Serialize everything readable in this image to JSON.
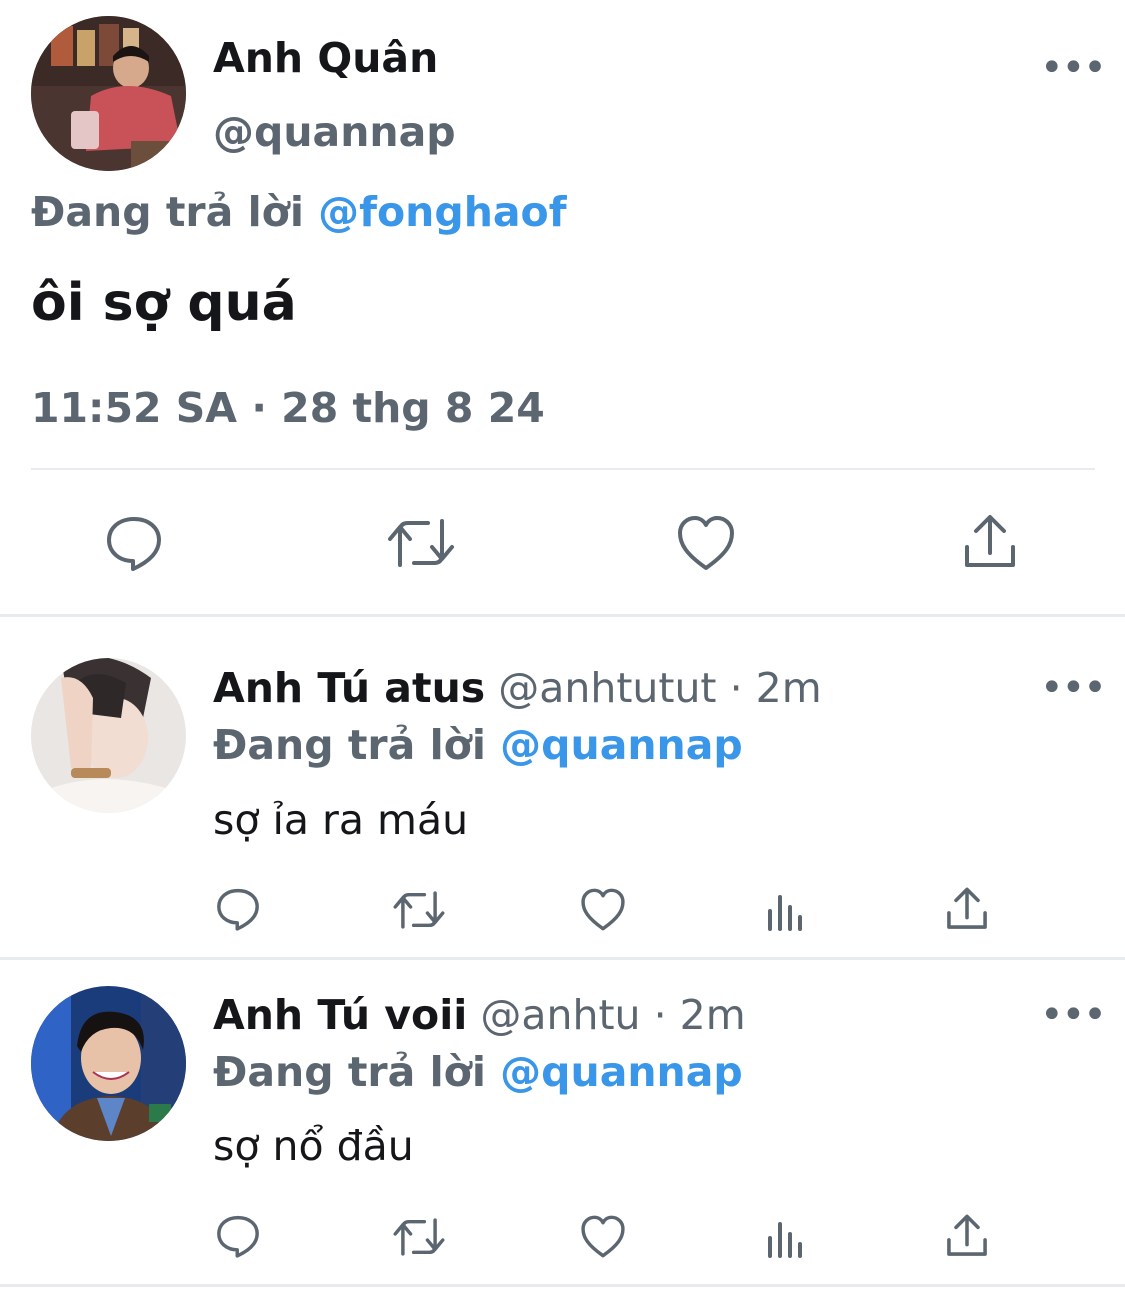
{
  "main_tweet": {
    "author_name": "Anh Quân",
    "handle": "@quannap",
    "replying_prefix": "Đang trả lời",
    "replying_to": "@fonghaof",
    "text": "ôi sợ quá",
    "timestamp": "11:52 SA · 28 thg 8 24",
    "more_label": "•••"
  },
  "replies": [
    {
      "author_name": "Anh Tú atus",
      "handle": "@anhtutut",
      "time": "· 2m",
      "replying_prefix": "Đang trả lời",
      "replying_to": "@quannap",
      "text": "sợ ỉa ra máu",
      "more_label": "•••"
    },
    {
      "author_name": "Anh Tú voii",
      "handle": "@anhtu",
      "time": "· 2m",
      "replying_prefix": "Đang trả lời",
      "replying_to": "@quannap",
      "text": "sợ nổ đầu",
      "more_label": "•••"
    }
  ],
  "icons": {
    "reply": "reply-icon",
    "retweet": "retweet-icon",
    "like": "heart-icon",
    "views": "analytics-icon",
    "share": "share-icon"
  },
  "colors": {
    "text": "#141619",
    "secondary": "#5b6670",
    "link": "#3a96e8",
    "divider": "#e8ebed"
  }
}
